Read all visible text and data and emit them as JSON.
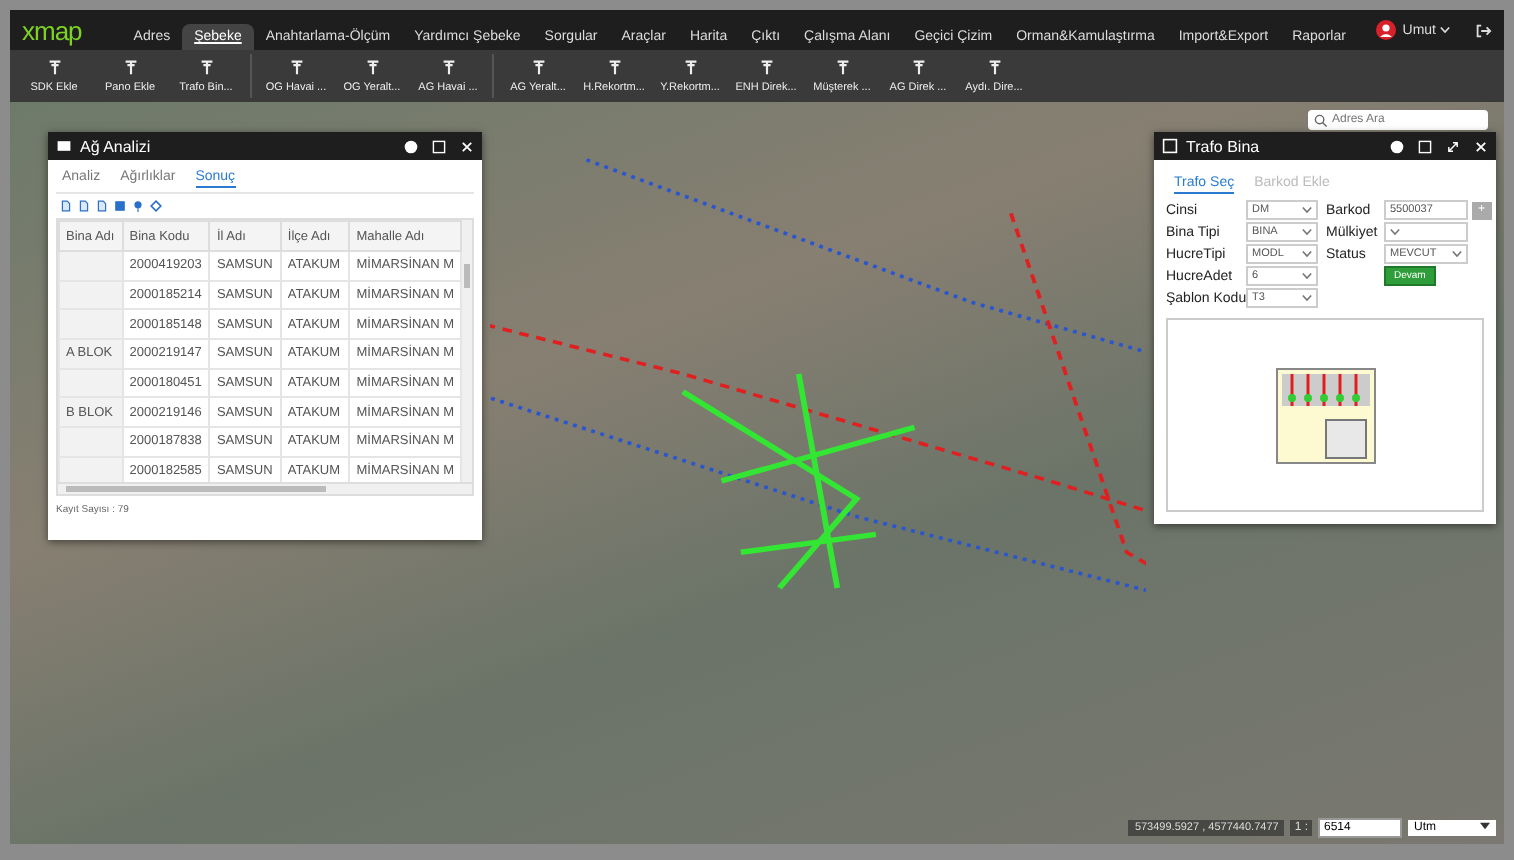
{
  "app": {
    "logo": "xmap",
    "user": "Umut"
  },
  "menu": [
    {
      "label": "Adres",
      "selected": false
    },
    {
      "label": "Şebeke",
      "selected": true
    },
    {
      "label": "Anahtarlama-Ölçüm",
      "selected": false
    },
    {
      "label": "Yardımcı Şebeke",
      "selected": false
    },
    {
      "label": "Sorgular",
      "selected": false
    },
    {
      "label": "Araçlar",
      "selected": false
    },
    {
      "label": "Harita",
      "selected": false
    },
    {
      "label": "Çıktı",
      "selected": false
    },
    {
      "label": "Çalışma Alanı",
      "selected": false
    },
    {
      "label": "Geçici Çizim",
      "selected": false
    },
    {
      "label": "Orman&Kamulaştırma",
      "selected": false
    },
    {
      "label": "Import&Export",
      "selected": false
    },
    {
      "label": "Raporlar",
      "selected": false
    }
  ],
  "toolbar_groups": [
    [
      "SDK Ekle",
      "Pano Ekle",
      "Trafo Bin..."
    ],
    [
      "OG Havai ...",
      "OG Yeralt...",
      "AG Havai ..."
    ],
    [
      "AG Yeralt...",
      "H.Rekortm...",
      "Y.Rekortm...",
      "ENH Direk...",
      "Müşterek ...",
      "AG Direk ...",
      "Aydı. Dire..."
    ]
  ],
  "map_search": {
    "placeholder": "Adres Ara"
  },
  "analysis_panel": {
    "title": "Ağ Analizi",
    "tabs": [
      {
        "label": "Analiz",
        "selected": false
      },
      {
        "label": "Ağırlıklar",
        "selected": false
      },
      {
        "label": "Sonuç",
        "selected": true
      }
    ],
    "table": {
      "columns": [
        "Bina Adı",
        "Bina Kodu",
        "İl Adı",
        "İlçe Adı",
        "Mahalle Adı"
      ],
      "rows": [
        [
          "",
          "2000419203",
          "SAMSUN",
          "ATAKUM",
          "MİMARSİNAN M"
        ],
        [
          "",
          "2000185214",
          "SAMSUN",
          "ATAKUM",
          "MİMARSİNAN M"
        ],
        [
          "",
          "2000185148",
          "SAMSUN",
          "ATAKUM",
          "MİMARSİNAN M"
        ],
        [
          "A BLOK",
          "2000219147",
          "SAMSUN",
          "ATAKUM",
          "MİMARSİNAN M"
        ],
        [
          "",
          "2000180451",
          "SAMSUN",
          "ATAKUM",
          "MİMARSİNAN M"
        ],
        [
          "B BLOK",
          "2000219146",
          "SAMSUN",
          "ATAKUM",
          "MİMARSİNAN M"
        ],
        [
          "",
          "2000187838",
          "SAMSUN",
          "ATAKUM",
          "MİMARSİNAN M"
        ],
        [
          "",
          "2000182585",
          "SAMSUN",
          "ATAKUM",
          "MİMARSİNAN M"
        ]
      ]
    },
    "footer": "Kayıt Sayısı : 79"
  },
  "trafo_panel": {
    "title": "Trafo Bina",
    "tabs": [
      {
        "label": "Trafo Seç",
        "selected": true
      },
      {
        "label": "Barkod Ekle",
        "selected": false
      }
    ],
    "left_fields": [
      {
        "label": "Cinsi",
        "value": "DM"
      },
      {
        "label": "Bina Tipi",
        "value": "BINA"
      },
      {
        "label": "HucreTipi",
        "value": "MODL"
      },
      {
        "label": "HucreAdet",
        "value": "6"
      },
      {
        "label": "Şablon Kodu",
        "value": "T3"
      }
    ],
    "right_fields": [
      {
        "label": "Barkod",
        "value": "5500037",
        "kind": "text"
      },
      {
        "label": "Mülkiyet",
        "kind": "select"
      },
      {
        "label": "Status",
        "value": "MEVCUT",
        "kind": "select"
      }
    ],
    "add_button": "+",
    "continue_button": "Devam"
  },
  "status": {
    "coordinates": "573499.5927 , 4577440.7477",
    "scale_prefix": "1 :",
    "scale": "6514",
    "projection": "Utm"
  }
}
